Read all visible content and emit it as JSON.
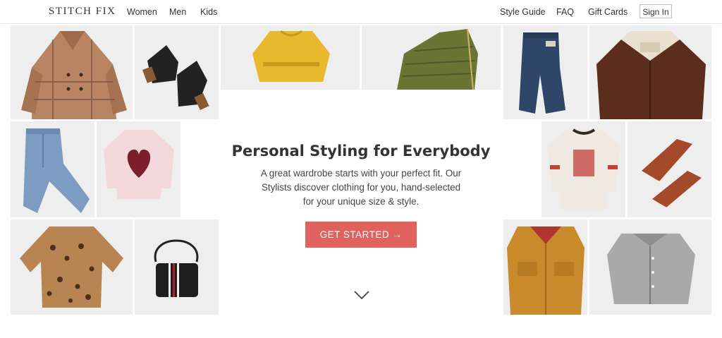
{
  "brand": {
    "name": "STITCH FIX"
  },
  "nav": {
    "left": [
      "Women",
      "Men",
      "Kids"
    ],
    "right": [
      "Style Guide",
      "FAQ",
      "Gift Cards"
    ],
    "signin": "Sign In"
  },
  "hero": {
    "headline": "Personal Styling for Everybody",
    "subtext": "A great wardrobe starts with your perfect fit. Our Stylists discover clothing for you, hand-selected for your unique size & style.",
    "cta": "GET STARTED →",
    "scroll_icon": "chevron-down-icon"
  },
  "tiles": [
    {
      "name": "plaid-coat",
      "color": "#b98461"
    },
    {
      "name": "black-ankle-boots",
      "color": "#222222"
    },
    {
      "name": "mustard-sweater",
      "color": "#e8b82e"
    },
    {
      "name": "olive-puffer-jacket",
      "color": "#6a7534"
    },
    {
      "name": "dark-jeans",
      "color": "#2e4768"
    },
    {
      "name": "brown-corduroy-jacket",
      "color": "#5a2d1c"
    },
    {
      "name": "light-jeans",
      "color": "#7d9cc2"
    },
    {
      "name": "heart-sweater",
      "color": "#f2d8da"
    },
    {
      "name": "graphic-tee",
      "color": "#efe9e1"
    },
    {
      "name": "brown-sneakers",
      "color": "#a44a2a"
    },
    {
      "name": "leopard-top",
      "color": "#9b6a3f"
    },
    {
      "name": "black-crossbody-bag",
      "color": "#1e1e1e"
    },
    {
      "name": "mustard-shirt-jacket",
      "color": "#c98a2c"
    },
    {
      "name": "gray-button-shirt",
      "color": "#a9a9a9"
    }
  ]
}
